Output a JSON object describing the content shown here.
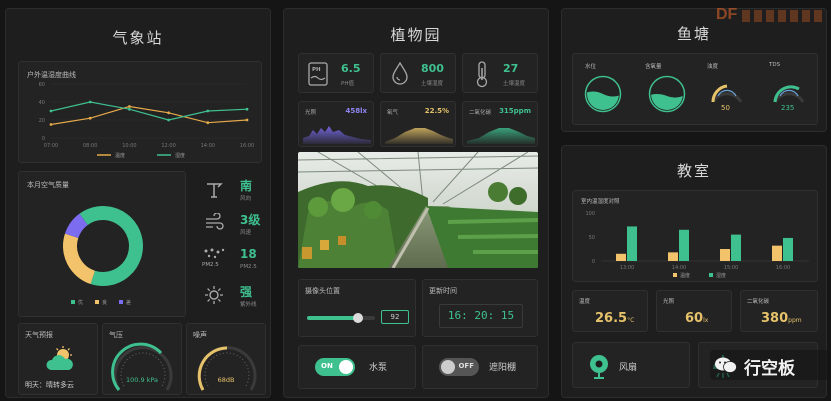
{
  "weather": {
    "title": "气象站",
    "temp_humidity": {
      "label": "户外温湿度曲线",
      "y_ticks": [
        "60",
        "40",
        "20",
        "0"
      ],
      "x_ticks": [
        "07:00",
        "08:00",
        "10:00",
        "12:00",
        "14:00",
        "16:00"
      ],
      "legend": [
        "温度",
        "湿度"
      ]
    },
    "air_quality": {
      "label": "本月空气质量",
      "legend": [
        "优",
        "良",
        "差"
      ]
    },
    "wind_dir": {
      "value": "南",
      "label": "风向"
    },
    "wind_speed": {
      "value": "3级",
      "label": "风速"
    },
    "pm25": {
      "value": "18",
      "label": "PM2.5",
      "icon_text": "PM2.5"
    },
    "uv": {
      "value": "强",
      "label": "紫外线"
    },
    "forecast": {
      "label": "天气预报",
      "text": "明天：晴转多云"
    },
    "pressure": {
      "label": "气压",
      "value": "100.9 kPa"
    },
    "noise": {
      "label": "噪声",
      "value": "68dB"
    }
  },
  "plant": {
    "title": "植物园",
    "ph": {
      "value": "6.5",
      "label": "PH值",
      "icon_text": "PH"
    },
    "soil_humidity": {
      "value": "800",
      "label": "土壤湿度"
    },
    "soil_temp": {
      "value": "27",
      "label": "土壤温度"
    },
    "light": {
      "label": "光照",
      "value": "458lx"
    },
    "oxygen": {
      "label": "氧气",
      "value": "22.5%"
    },
    "co2": {
      "label": "二氧化碳",
      "value": "315ppm"
    },
    "camera": {
      "label": "摄像头位置",
      "value": "92"
    },
    "update": {
      "label": "更新时间",
      "value": "16: 20: 15"
    },
    "pump": {
      "state": "ON",
      "label": "水泵"
    },
    "shade": {
      "state": "OFF",
      "label": "遮阳棚"
    }
  },
  "pond": {
    "title": "鱼塘",
    "water_level": {
      "label": "水位"
    },
    "oxygen": {
      "label": "含氧量"
    },
    "turbidity": {
      "label": "浊度",
      "value": "50"
    },
    "tds": {
      "label": "TDS",
      "value": "235"
    }
  },
  "classroom": {
    "title": "教室",
    "chart_label": "室内温湿度对照",
    "y_ticks": [
      "100",
      "50",
      "0"
    ],
    "x_ticks": [
      "13:00",
      "14:00",
      "15:00",
      "16:00"
    ],
    "legend": [
      "温度",
      "湿度"
    ],
    "temperature": {
      "label": "温度",
      "value": "26.5",
      "unit": "°C"
    },
    "light": {
      "label": "光照",
      "value": "60",
      "unit": "lx"
    },
    "co2": {
      "label": "二氧化碳",
      "value": "380",
      "unit": "ppm"
    },
    "fan": {
      "label": "风扇"
    },
    "lamp": {
      "label": ""
    }
  },
  "watermark": {
    "brand": "行空板",
    "logo": "DF"
  },
  "chart_data": [
    {
      "type": "line",
      "title": "户外温湿度曲线",
      "x": [
        "07:00",
        "08:00",
        "10:00",
        "12:00",
        "14:00",
        "16:00"
      ],
      "series": [
        {
          "name": "温度",
          "values": [
            15,
            22,
            35,
            28,
            17,
            20
          ]
        },
        {
          "name": "湿度",
          "values": [
            30,
            40,
            32,
            20,
            30,
            32
          ]
        }
      ],
      "ylim": [
        0,
        60
      ],
      "colors": [
        "#e6a94a",
        "#3fc08f"
      ]
    },
    {
      "type": "pie",
      "title": "本月空气质量",
      "categories": [
        "优",
        "良",
        "差"
      ],
      "values": [
        65,
        25,
        10
      ],
      "colors": [
        "#3fc08f",
        "#f2c36b",
        "#7b6cf0"
      ]
    },
    {
      "type": "bar",
      "title": "室内温湿度对照",
      "categories": [
        "13:00",
        "14:00",
        "15:00",
        "16:00"
      ],
      "series": [
        {
          "name": "温度",
          "values": [
            15,
            18,
            25,
            32
          ]
        },
        {
          "name": "湿度",
          "values": [
            72,
            65,
            55,
            48
          ]
        }
      ],
      "ylim": [
        0,
        100
      ],
      "colors": [
        "#f2c36b",
        "#3fc08f"
      ]
    }
  ]
}
